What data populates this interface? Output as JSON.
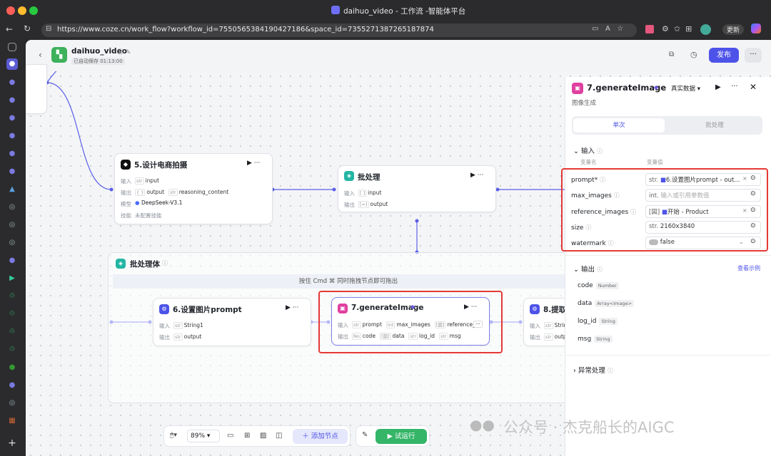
{
  "window": {
    "title": "daihuo_video - 工作流 -智能体平台"
  },
  "browser": {
    "url": "https://www.coze.cn/work_flow?workflow_id=7550565384190427186&space_id=7355271387265187874",
    "update_label": "更新"
  },
  "header": {
    "name": "daihuo_video",
    "autosave": "已自动保存 01:13:00",
    "publish_label": "发布"
  },
  "nodes": {
    "n5": {
      "title": "5.设计电商拍摄",
      "input_label": "输入",
      "output_label": "输出",
      "model_label": "模型",
      "skill_label": "技能",
      "inputs": [
        "input"
      ],
      "outputs": [
        "output",
        "reasoning_content"
      ],
      "model": "DeepSeek-V3.1",
      "skill": "未配置技能"
    },
    "batch": {
      "title": "批处理",
      "input_label": "输入",
      "output_label": "输出",
      "inputs": [
        "input"
      ],
      "outputs": [
        "output"
      ]
    },
    "n6": {
      "title": "6.设置图片prompt",
      "input_label": "输入",
      "output_label": "输出",
      "inputs": [
        "String1"
      ],
      "outputs": [
        "output"
      ]
    },
    "n7": {
      "title": "7.generateImage",
      "input_label": "输入",
      "output_label": "输出",
      "inputs": [
        "prompt",
        "max_images",
        "reference_"
      ],
      "outputs": [
        "code",
        "data",
        "log_id",
        "msg"
      ]
    },
    "n8": {
      "title": "8.提取",
      "input_label": "输入",
      "output_label": "输出",
      "inputs": [
        "Strin"
      ],
      "outputs": [
        "outp"
      ]
    }
  },
  "batch_body": {
    "title": "批处理体",
    "hint": "按住 Cmd ⌘ 同时拖拽节点即可拖出"
  },
  "panel": {
    "title": "7.generateImage",
    "data_mode": "真实数据",
    "subtitle": "图像生成",
    "tabs": [
      "单次",
      "批处理"
    ],
    "input_section": "输入",
    "col_name": "变量名",
    "col_value": "变量值",
    "inputs": [
      {
        "name": "prompt*",
        "type": "str.",
        "value": "6.设置图片prompt - out..."
      },
      {
        "name": "max_images",
        "type": "int.",
        "placeholder": "输入或引用参数值"
      },
      {
        "name": "reference_images",
        "type": "[図]",
        "value": "开始 - Product"
      },
      {
        "name": "size",
        "type": "str.",
        "value": "2160x3840"
      },
      {
        "name": "watermark",
        "type": "toggle",
        "value": "false"
      }
    ],
    "output_section": "输出",
    "example_link": "查看示例",
    "outputs": [
      {
        "name": "code",
        "type": "Number"
      },
      {
        "name": "data",
        "type": "Array<Image>"
      },
      {
        "name": "log_id",
        "type": "String"
      },
      {
        "name": "msg",
        "type": "String"
      }
    ],
    "error_section": "异常处理"
  },
  "toolbar": {
    "zoom": "89%",
    "add_node": "添加节点",
    "run": "试运行"
  },
  "watermark_text": "公众号 · 杰克船长的AIGC"
}
